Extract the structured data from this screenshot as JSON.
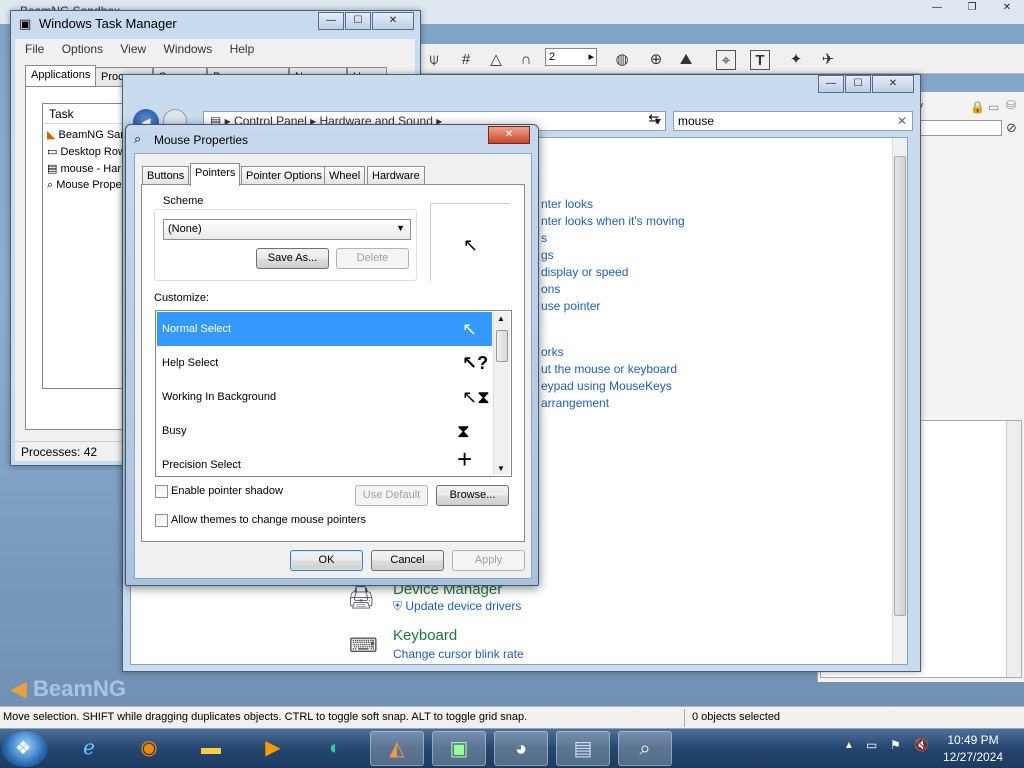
{
  "beamng": {
    "title": "BeamNG Sandbox",
    "status_hint": "Move selection. SHIFT while dragging duplicates objects.  CTRL to toggle soft snap.  ALT to toggle grid snap.",
    "status_selection": "0 objects selected",
    "number_field": "2",
    "logo_text": "BeamNG",
    "right_panel_label": "ry"
  },
  "task_manager": {
    "title": "Windows Task Manager",
    "menu": [
      "File",
      "Options",
      "View",
      "Windows",
      "Help"
    ],
    "tabs": [
      "Applications",
      "Proce",
      "S",
      "P",
      "N",
      "U"
    ],
    "column_task": "Task",
    "rows": [
      "BeamNG San",
      "Desktop Row",
      "mouse - Har",
      "Mouse Prope"
    ],
    "processes": "Processes: 42"
  },
  "explorer": {
    "breadcrumb": [
      "Control Panel",
      "Hardware and Sound"
    ],
    "search_value": "mouse",
    "links": [
      "nter looks",
      "nter looks when it's moving",
      "s",
      "gs",
      "display or speed",
      "ons",
      "use pointer",
      "orks",
      "ut the mouse or keyboard",
      "eypad using MouseKeys",
      "arrangement"
    ],
    "device_manager": "Device Manager",
    "update_drivers": "Update device drivers",
    "keyboard": "Keyboard",
    "cursor_blink": "Change cursor blink rate"
  },
  "dialog": {
    "title": "Mouse Properties",
    "tabs": [
      "Buttons",
      "Pointers",
      "Pointer Options",
      "Wheel",
      "Hardware"
    ],
    "scheme_label": "Scheme",
    "scheme_value": "(None)",
    "save_as": "Save As...",
    "delete": "Delete",
    "customize_label": "Customize:",
    "cursors": [
      {
        "label": "Normal Select",
        "icon": "arrow-cursor-icon",
        "glyph": "➤"
      },
      {
        "label": "Help Select",
        "icon": "help-cursor-icon",
        "glyph": "↖?"
      },
      {
        "label": "Working In Background",
        "icon": "busy-arrow-cursor-icon",
        "glyph": "↖⧗"
      },
      {
        "label": "Busy",
        "icon": "hourglass-icon",
        "glyph": "⧗"
      },
      {
        "label": "Precision Select",
        "icon": "crosshair-icon",
        "glyph": "+"
      }
    ],
    "enable_shadow": "Enable pointer shadow",
    "use_default": "Use Default",
    "browse": "Browse...",
    "allow_themes": "Allow themes to change mouse pointers",
    "ok": "OK",
    "cancel": "Cancel",
    "apply": "Apply"
  },
  "taskbar": {
    "time": "10:49 PM",
    "date": "12/27/2024"
  },
  "colors": {
    "selection": "#3399ff",
    "link": "#1e5fb4",
    "heading_green": "#1e7a3a"
  }
}
